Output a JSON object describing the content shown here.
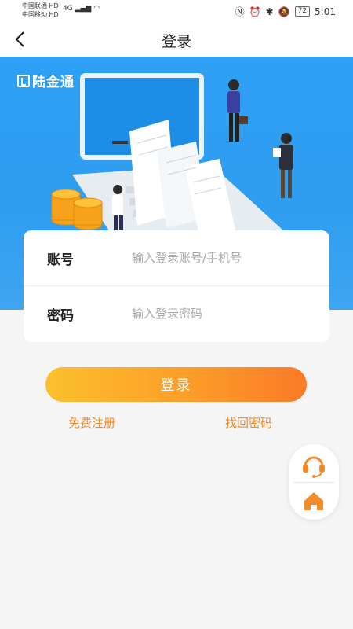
{
  "status_bar": {
    "carrier1": "中国联通 HD",
    "carrier2": "中国移动 HD",
    "signal": "4G",
    "battery": "72",
    "time": "5:01"
  },
  "nav": {
    "title": "登录"
  },
  "banner": {
    "logo_text": "陆金通"
  },
  "form": {
    "account_label": "账号",
    "account_placeholder": "输入登录账号/手机号",
    "password_label": "密码",
    "password_placeholder": "输入登录密码"
  },
  "actions": {
    "login_label": "登录",
    "register_label": "免费注册",
    "recover_label": "找回密码"
  },
  "colors": {
    "brand_blue": "#2ea0f5",
    "accent_orange": "#f58a2b"
  }
}
